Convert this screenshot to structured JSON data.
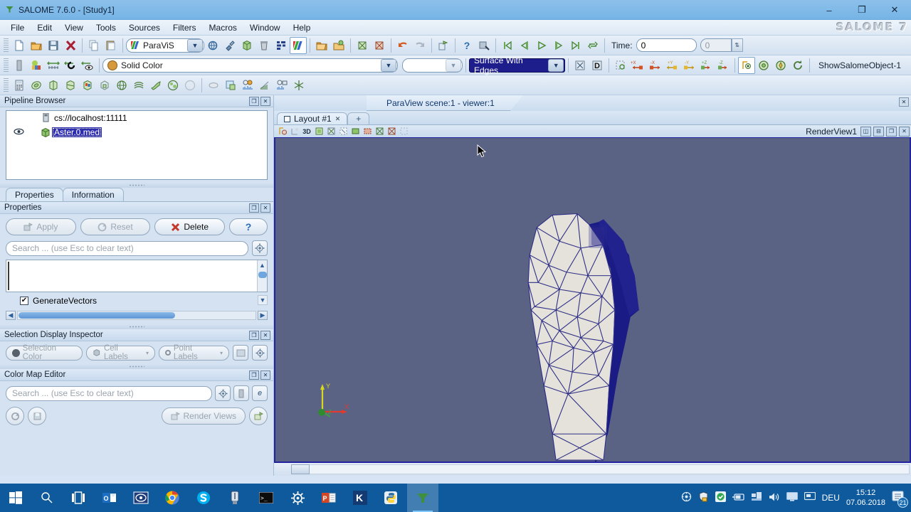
{
  "window": {
    "title": "SALOME 7.6.0 - [Study1]",
    "app_icon": "salome-icon",
    "minimize": "–",
    "maximize": "❐",
    "close": "✕",
    "logo": "SALOME 7"
  },
  "menu": {
    "items": [
      "File",
      "Edit",
      "View",
      "Tools",
      "Sources",
      "Filters",
      "Macros",
      "Window",
      "Help"
    ]
  },
  "toolbar_main": {
    "module_combo": "ParaViS",
    "time_label": "Time:",
    "time_value": "0",
    "time_index": "0"
  },
  "toolbar_display": {
    "color_by": "Solid Color",
    "representation": "Surface With Edges",
    "object_label": "ShowSalomeObject-1"
  },
  "pipeline": {
    "title": "Pipeline Browser",
    "server": "cs://localhost:11111",
    "source": "Aster.0.med"
  },
  "tabs": {
    "properties": "Properties",
    "information": "Information"
  },
  "properties": {
    "title": "Properties",
    "apply": "Apply",
    "reset": "Reset",
    "delete": "Delete",
    "help": "?",
    "search_placeholder": "Search ... (use Esc to clear text)",
    "generate_vectors": "GenerateVectors",
    "generate_vectors_checked": "✔"
  },
  "selection_inspector": {
    "title": "Selection Display Inspector",
    "selection_color": "Selection Color",
    "cell_labels": "Cell Labels",
    "point_labels": "Point Labels"
  },
  "color_map_editor": {
    "title": "Color Map Editor",
    "search_placeholder": "Search ... (use Esc to clear text)",
    "render_views": "Render Views",
    "edit_badge": "e"
  },
  "view": {
    "scene_title": "ParaView scene:1 - viewer:1",
    "layout_tab": "Layout #1",
    "add_tab": "+",
    "render_view_name": "RenderView1",
    "mode_3d": "3D",
    "axes": {
      "x": "X",
      "y": "Y",
      "z": "Z"
    },
    "background_color": "#5b6385",
    "mesh_face_color": "#e4e2da",
    "mesh_edge_color": "#2f2f86",
    "mesh_side_color": "#181878"
  },
  "taskbar": {
    "apps": [
      "windows-start-icon",
      "search-icon",
      "task-view-icon",
      "outlook-icon",
      "scanner-icon",
      "chrome-icon",
      "skype-icon",
      "usb-icon",
      "terminal-icon",
      "settings-icon",
      "powerpoint-icon",
      "kile-icon",
      "python-icon",
      "salome-icon"
    ],
    "tray_icons": [
      "vmware-icon",
      "security-icon",
      "antivirus-icon",
      "battery-icon",
      "network-icon",
      "volume-icon",
      "display-icon",
      "monitor-icon"
    ],
    "language": "DEU",
    "time": "15:12",
    "date": "07.06.2018",
    "notification_count": "21"
  }
}
